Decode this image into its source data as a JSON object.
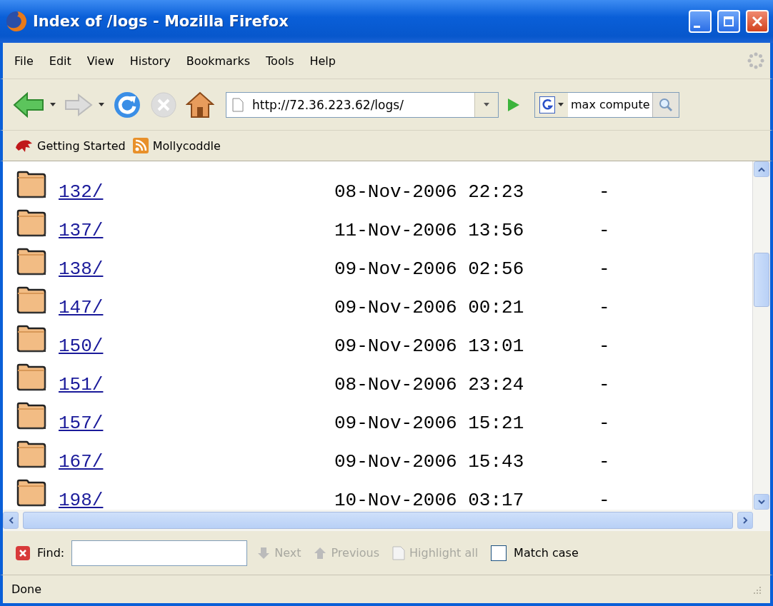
{
  "window": {
    "title": "Index of /logs - Mozilla Firefox"
  },
  "menu": [
    "File",
    "Edit",
    "View",
    "History",
    "Bookmarks",
    "Tools",
    "Help"
  ],
  "toolbar": {
    "url": "http://72.36.223.62/logs/",
    "search": "max compute"
  },
  "bookmarks": [
    "Getting Started",
    "Mollycoddle"
  ],
  "listing": [
    {
      "name": "132/",
      "modified": "08-Nov-2006 22:23",
      "size": "-"
    },
    {
      "name": "137/",
      "modified": "11-Nov-2006 13:56",
      "size": "-"
    },
    {
      "name": "138/",
      "modified": "09-Nov-2006 02:56",
      "size": "-"
    },
    {
      "name": "147/",
      "modified": "09-Nov-2006 00:21",
      "size": "-"
    },
    {
      "name": "150/",
      "modified": "09-Nov-2006 13:01",
      "size": "-"
    },
    {
      "name": "151/",
      "modified": "08-Nov-2006 23:24",
      "size": "-"
    },
    {
      "name": "157/",
      "modified": "09-Nov-2006 15:21",
      "size": "-"
    },
    {
      "name": "167/",
      "modified": "09-Nov-2006 15:43",
      "size": "-"
    },
    {
      "name": "198/",
      "modified": "10-Nov-2006 03:17",
      "size": "-"
    }
  ],
  "find_bar": {
    "label": "Find:",
    "buttons": [
      {
        "label": "Next",
        "disabled": true
      },
      {
        "label": "Previous",
        "disabled": true
      },
      {
        "label": "Highlight all",
        "disabled": true
      }
    ],
    "match_case": {
      "label": "Match case",
      "checked": false
    }
  },
  "status_bar": "Done"
}
